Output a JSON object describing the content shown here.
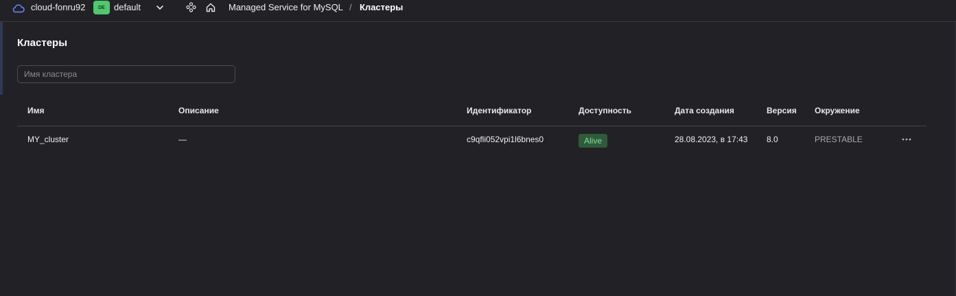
{
  "header": {
    "cloud_name": "cloud-fonru92",
    "folder_badge": "DE",
    "folder_name": "default",
    "breadcrumb": {
      "service": "Managed Service for MySQL",
      "separator": "/",
      "current": "Кластеры"
    }
  },
  "page": {
    "title": "Кластеры",
    "search": {
      "placeholder": "Имя кластера",
      "value": ""
    }
  },
  "table": {
    "columns": {
      "name": "Имя",
      "description": "Описание",
      "id": "Идентификатор",
      "status": "Доступность",
      "created": "Дата создания",
      "version": "Версия",
      "environment": "Окружение"
    },
    "rows": [
      {
        "name": "MY_cluster",
        "description": "—",
        "id": "c9qfli052vpi1l6bnes0",
        "status": "Alive",
        "created": "28.08.2023, в 17:43",
        "version": "8.0",
        "environment": "PRESTABLE"
      }
    ]
  },
  "colors": {
    "background": "#222226",
    "status_alive_bg": "#2f5a3b",
    "status_alive_text": "#7ee09a",
    "folder_badge_bg": "#4fc86f",
    "cloud_icon": "#6b8cff"
  },
  "icons": {
    "cloud": "cloud-icon",
    "chevron": "chevron-down-icon",
    "services": "services-icon",
    "home": "home-icon",
    "more": "more-icon"
  }
}
